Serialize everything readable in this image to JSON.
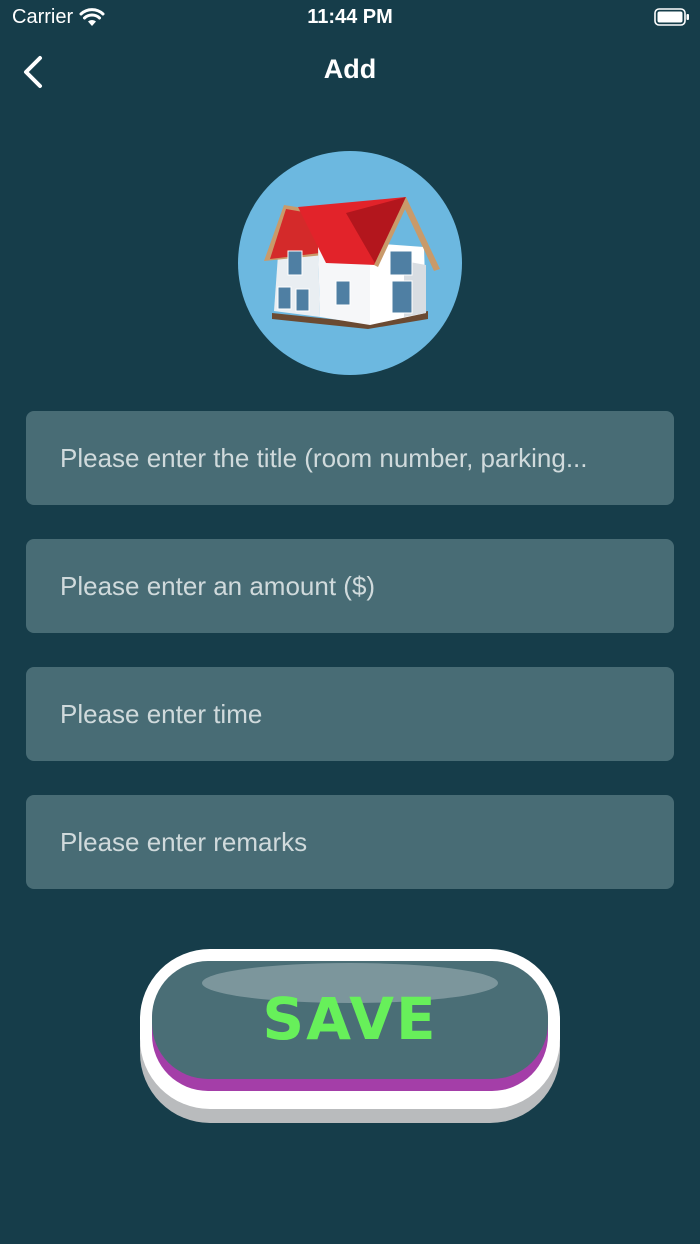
{
  "status_bar": {
    "carrier": "Carrier",
    "time": "11:44 PM"
  },
  "header": {
    "title": "Add"
  },
  "form": {
    "title_placeholder": "Please enter the title (room number, parking...",
    "amount_placeholder": "Please enter an amount ($)",
    "time_placeholder": "Please enter time",
    "remarks_placeholder": "Please enter remarks"
  },
  "save_button": {
    "label": "SAVE"
  },
  "colors": {
    "background": "#163d4a",
    "field": "#486c75",
    "save_text": "#67f05a",
    "avatar_bg": "#6cb8e0"
  },
  "icons": {
    "back": "chevron-left-icon",
    "house": "house-icon",
    "wifi": "wifi-icon",
    "battery": "battery-icon"
  }
}
